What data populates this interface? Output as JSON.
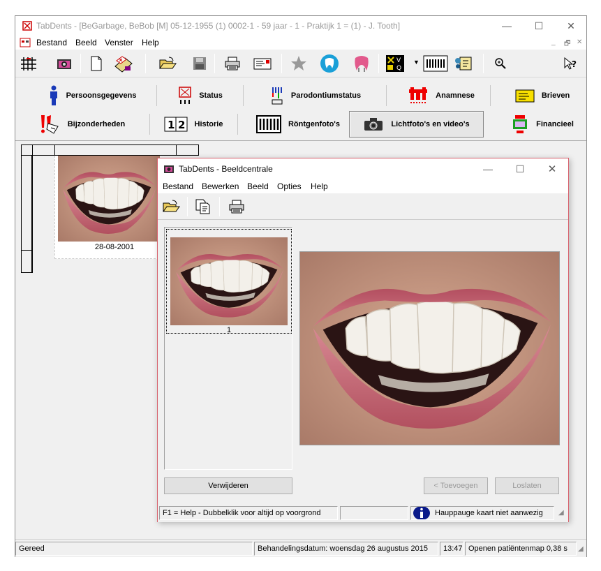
{
  "main": {
    "title": "TabDents - [BeGarbage, BeBob [M] 05-12-1955 (1) 0002-1 - 59 jaar - 1 - Praktijk 1 = (1) - J. Tooth]",
    "menu": [
      "Bestand",
      "Beeld",
      "Venster",
      "Help"
    ],
    "window_controls": {
      "minimize": "—",
      "maximize": "☐",
      "close": "✕"
    },
    "mdi_controls": {
      "minimize": "_",
      "restore": "🗗",
      "close": "✕"
    }
  },
  "toolbar": {
    "icons": [
      "grid-icon",
      "camera-icon",
      "new-document-icon",
      "patient-card-icon",
      "open-folder-icon",
      "save-icon",
      "print-icon",
      "letter-icon",
      "star-icon",
      "tooth-blue-icon",
      "tooth-pink-icon",
      "vq-icon",
      "xray-icon",
      "notes-icon",
      "zoom-icon",
      "help-pointer-icon"
    ]
  },
  "tabs": {
    "row1": [
      "Persoonsgegevens",
      "Status",
      "Parodontiumstatus",
      "Anamnese",
      "Brieven"
    ],
    "row2": [
      "Bijzonderheden",
      "Historie",
      "Röntgenfoto's",
      "Lichtfoto's en video's",
      "Financieel"
    ],
    "active": "Lichtfoto's en video's"
  },
  "workspace": {
    "photo_date": "28-08-2001"
  },
  "dialog": {
    "title": "TabDents - Beeldcentrale",
    "menu": [
      "Bestand",
      "Bewerken",
      "Beeld",
      "Opties",
      "Help"
    ],
    "window_controls": {
      "minimize": "—",
      "maximize": "☐",
      "close": "✕"
    },
    "thumbnail_label": "1",
    "buttons": {
      "delete": "Verwijderen",
      "add": "< Toevoegen",
      "release": "Loslaten"
    },
    "status": {
      "help": "F1 = Help - Dubbelklik voor altijd op voorgrond",
      "capture": "Hauppauge kaart niet aanwezig"
    }
  },
  "statusbar": {
    "ready": "Gereed",
    "treatment_date": "Behandelingsdatum: woensdag 26 augustus 2015",
    "time": "13:47",
    "info": "Openen patiëntenmap 0,38 s"
  },
  "colors": {
    "lip": "#c0606e",
    "teeth": "#f4f2ee",
    "skin": "#c89a84",
    "active_border": "#d6606c"
  }
}
